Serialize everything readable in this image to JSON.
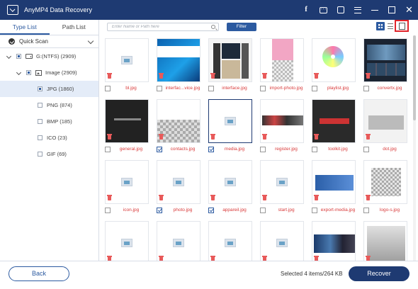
{
  "app": {
    "title": "AnyMP4 Data Recovery"
  },
  "left_panel": {
    "tabs": [
      "Type List",
      "Path List"
    ],
    "quick_scan": "Quick Scan",
    "drive": "G:(NTFS) (2909)",
    "category": "Image (2909)",
    "types": [
      "JPG (1860)",
      "PNG (874)",
      "BMP (185)",
      "ICO (23)",
      "GIF (69)"
    ]
  },
  "toolbar": {
    "search_placeholder": "Enter Name or Path here",
    "filter_label": "Filter"
  },
  "files": [
    [
      "bl.jpg",
      "interfac...vice.jpg",
      "interface.jpg",
      "import-photo.jpg",
      "playlist.jpg",
      "convertx.jpg"
    ],
    [
      "general.jpg",
      "contacts.jpg",
      "media.jpg",
      "register.jpg",
      "toolkit.jpg",
      "dot.jpg"
    ],
    [
      "icon.jpg",
      "photo.jpg",
      "appareil.jpg",
      "start.jpg",
      "export-media.jpg",
      "logo-s.jpg"
    ]
  ],
  "footer": {
    "back_label": "Back",
    "status": "Selected 4 items/264 KB",
    "recover_label": "Recover"
  },
  "colors": {
    "brand": "#1e3a72",
    "accent": "#2c5aa0",
    "filename": "#d93a3a",
    "highlight": "#e0242a"
  }
}
